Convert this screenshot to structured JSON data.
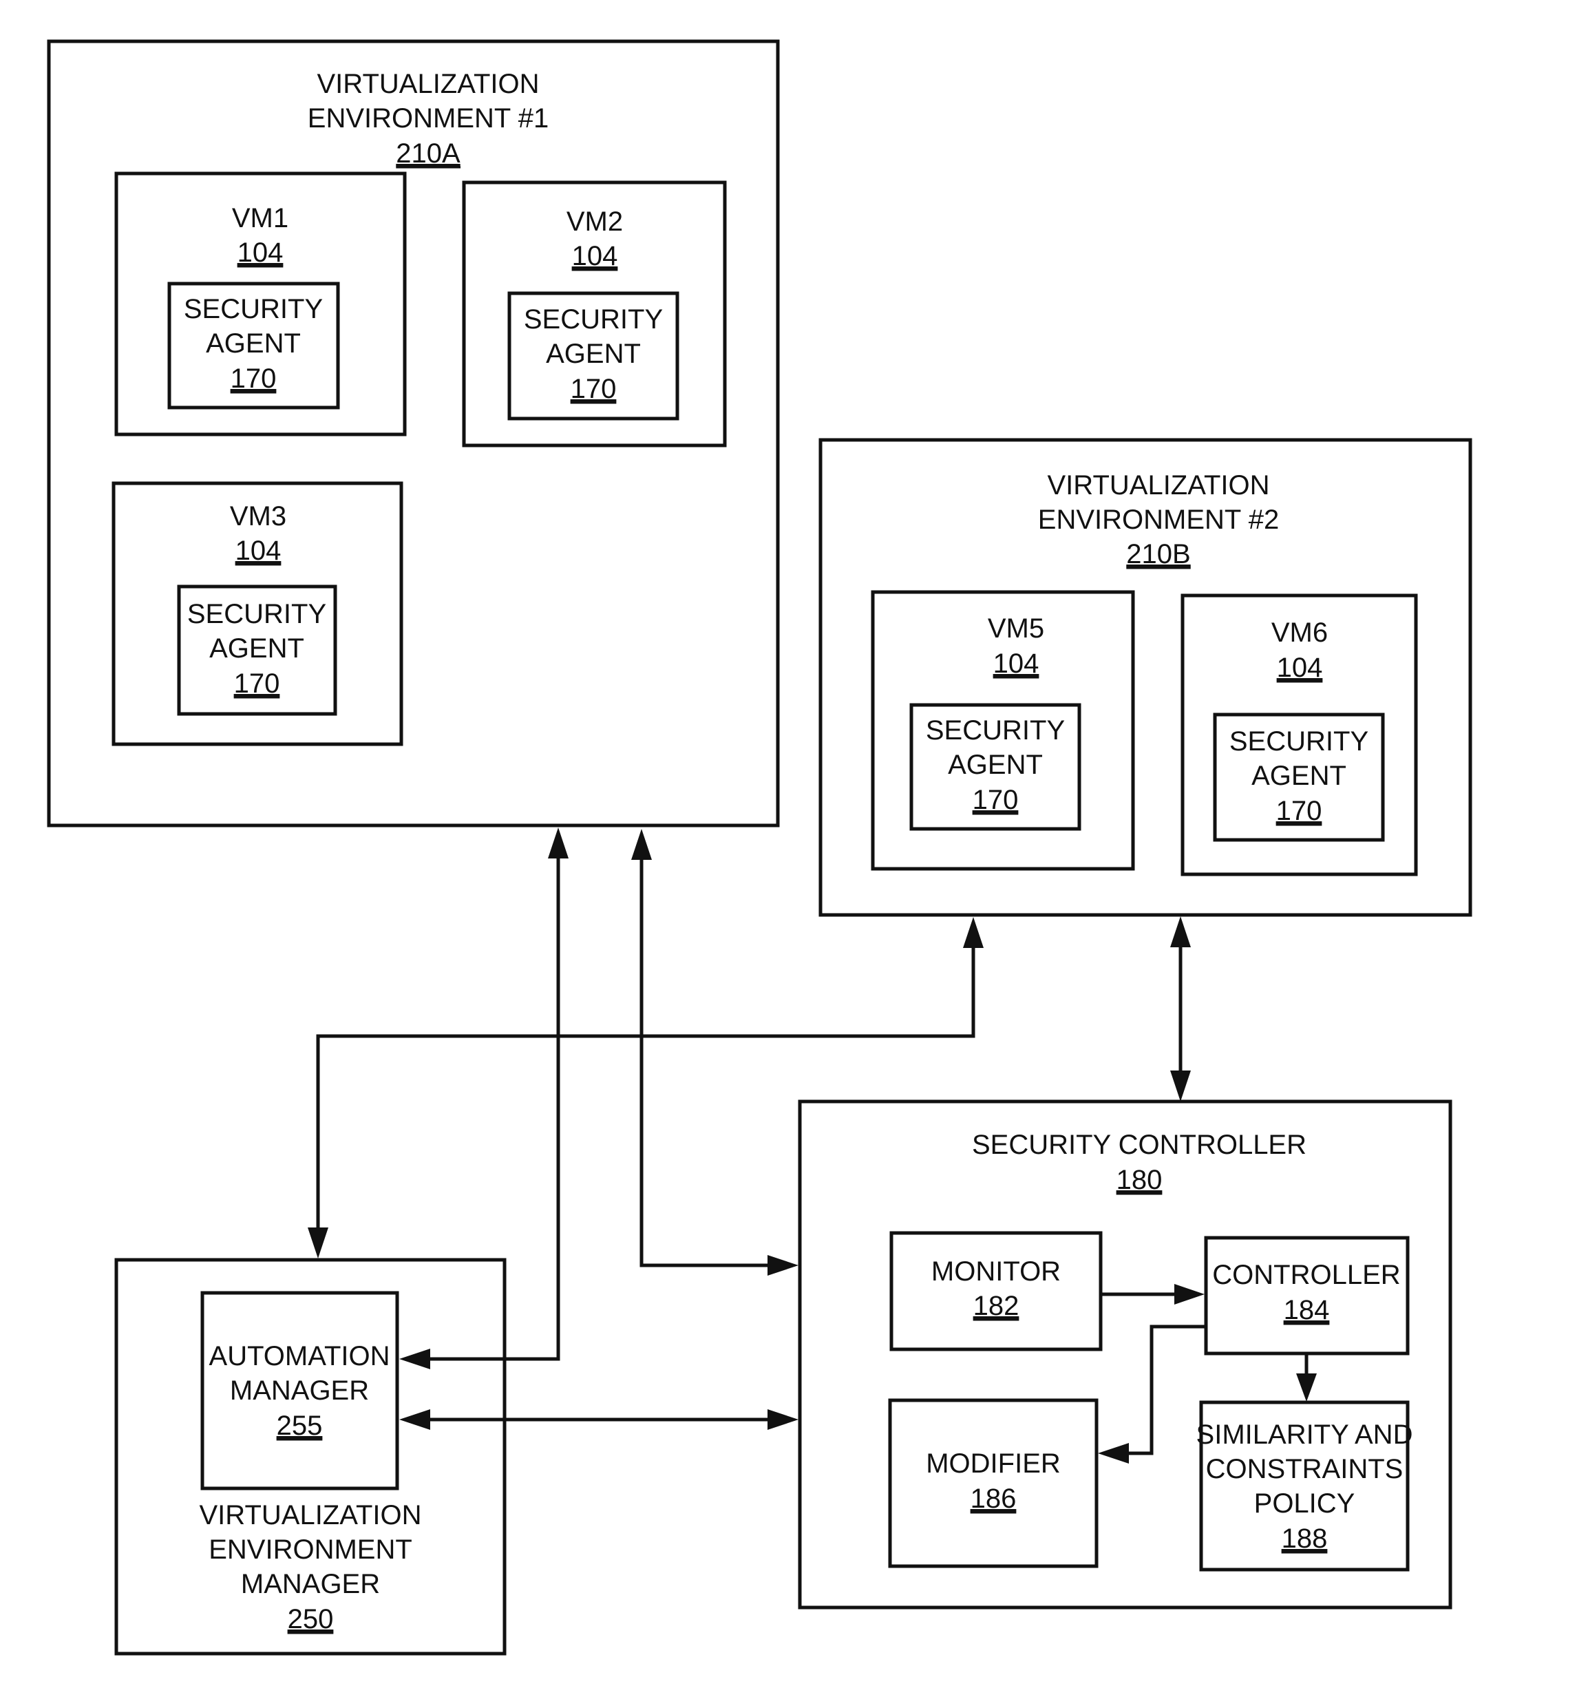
{
  "diagram": {
    "env1": {
      "lines": [
        "VIRTUALIZATION",
        "ENVIRONMENT #1"
      ],
      "ref": "210A",
      "vms": [
        {
          "name": "VM1",
          "ref": "104",
          "agent": {
            "lines": [
              "SECURITY",
              "AGENT"
            ],
            "ref": "170"
          }
        },
        {
          "name": "VM2",
          "ref": "104",
          "agent": {
            "lines": [
              "SECURITY",
              "AGENT"
            ],
            "ref": "170"
          }
        },
        {
          "name": "VM3",
          "ref": "104",
          "agent": {
            "lines": [
              "SECURITY",
              "AGENT"
            ],
            "ref": "170"
          }
        }
      ]
    },
    "env2": {
      "lines": [
        "VIRTUALIZATION",
        "ENVIRONMENT #2"
      ],
      "ref": "210B",
      "vms": [
        {
          "name": "VM5",
          "ref": "104",
          "agent": {
            "lines": [
              "SECURITY",
              "AGENT"
            ],
            "ref": "170"
          }
        },
        {
          "name": "VM6",
          "ref": "104",
          "agent": {
            "lines": [
              "SECURITY",
              "AGENT"
            ],
            "ref": "170"
          }
        }
      ]
    },
    "security_controller": {
      "lines": [
        "SECURITY CONTROLLER"
      ],
      "ref": "180",
      "monitor": {
        "lines": [
          "MONITOR"
        ],
        "ref": "182"
      },
      "controller": {
        "lines": [
          "CONTROLLER"
        ],
        "ref": "184"
      },
      "modifier": {
        "lines": [
          "MODIFIER"
        ],
        "ref": "186"
      },
      "policy": {
        "lines": [
          "SIMILARITY AND",
          "CONSTRAINTS",
          "POLICY"
        ],
        "ref": "188"
      }
    },
    "env_manager": {
      "lines": [
        "VIRTUALIZATION",
        "ENVIRONMENT",
        "MANAGER"
      ],
      "ref": "250",
      "automation": {
        "lines": [
          "AUTOMATION",
          "MANAGER"
        ],
        "ref": "255"
      }
    }
  }
}
